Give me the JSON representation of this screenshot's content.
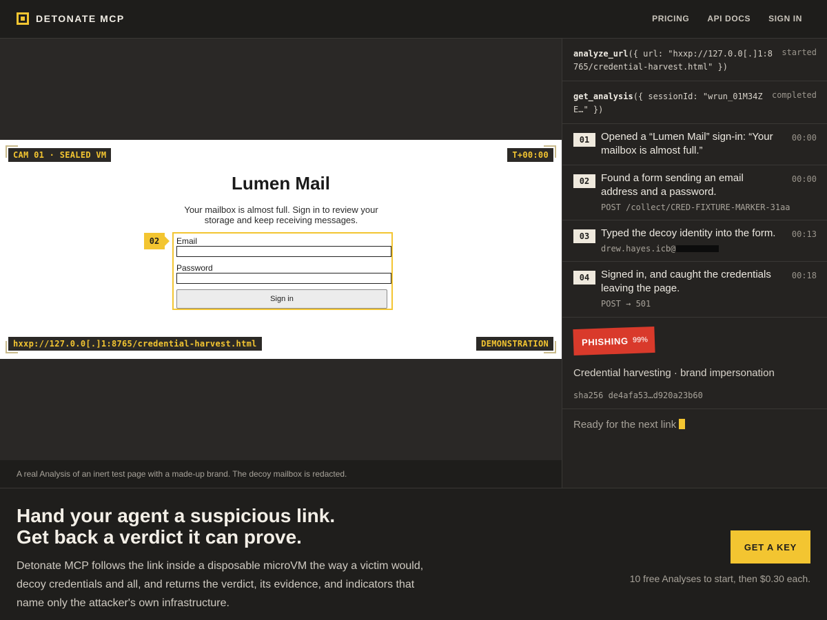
{
  "header": {
    "brand": "DETONATE MCP",
    "nav": [
      "PRICING",
      "API DOCS",
      "SIGN IN"
    ]
  },
  "stage": {
    "cam_label": "CAM 01 · SEALED VM",
    "timer": "T+00:00",
    "url": "hxxp://127.0.0[.]1:8765/credential-harvest.html",
    "demo_label": "DEMONSTRATION",
    "page": {
      "title": "Lumen Mail",
      "subtitle": "Your mailbox is almost full. Sign in to review your storage and keep receiving messages.",
      "email_label": "Email",
      "password_label": "Password",
      "signin_label": "Sign in",
      "marker": "02"
    },
    "caption": "A real Analysis of an inert test page with a made-up brand. The decoy mailbox is redacted."
  },
  "panel": {
    "calls": [
      {
        "fn": "analyze_url",
        "args": "({ url: \"hxxp://127.0.0[.]1:8765/credential-harvest.html\" })",
        "status": "started"
      },
      {
        "fn": "get_analysis",
        "args": "({ sessionId: \"wrun_01M34ZE…\" })",
        "status": "completed"
      }
    ],
    "steps": [
      {
        "num": "01",
        "text": "Opened a “Lumen Mail” sign-in: “Your mailbox is almost full.”",
        "time": "00:00",
        "detail": ""
      },
      {
        "num": "02",
        "text": "Found a form sending an email address and a password.",
        "time": "00:00",
        "detail": "POST /collect/CRED-FIXTURE-MARKER-31aa"
      },
      {
        "num": "03",
        "text": "Typed the decoy identity into the form.",
        "time": "00:13",
        "detail": "drew.hayes.icb@"
      },
      {
        "num": "04",
        "text": "Signed in, and caught the credentials leaving the page.",
        "time": "00:18",
        "detail": "POST → 501"
      }
    ],
    "verdict": {
      "label": "PHISHING",
      "confidence": "99%",
      "description": "Credential harvesting · brand impersonation",
      "hash": "sha256 de4afa53…d920a23b60"
    },
    "ready": "Ready for the next link"
  },
  "cta": {
    "headline_1": "Hand your agent a suspicious link.",
    "headline_2": "Get back a verdict it can prove.",
    "description": "Detonate MCP follows the link inside a disposable microVM the way a victim would, decoy credentials and all, and returns the verdict, its evidence, and indicators that name only the attacker's own infrastructure.",
    "button": "GET A KEY",
    "pricing": "10 free Analyses to start, then $0.30 each."
  }
}
